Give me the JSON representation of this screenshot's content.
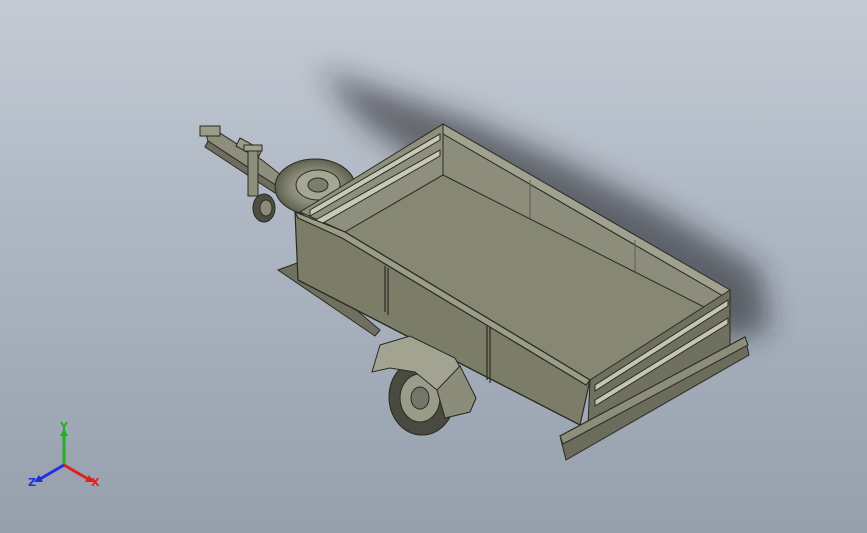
{
  "viewport": {
    "name": "3D model view",
    "background_top": "#c4cbd5",
    "background_bottom": "#96a0ad"
  },
  "model": {
    "name": "utility-trailer",
    "body_color": "#7e7f6a",
    "floor_color": "#8a8b77",
    "dark_color": "#5f6052"
  },
  "triad": {
    "x_label": "X",
    "y_label": "Y",
    "z_label": "Z",
    "x_color": "#e0201c",
    "y_color": "#22b022",
    "z_color": "#2030e0"
  }
}
